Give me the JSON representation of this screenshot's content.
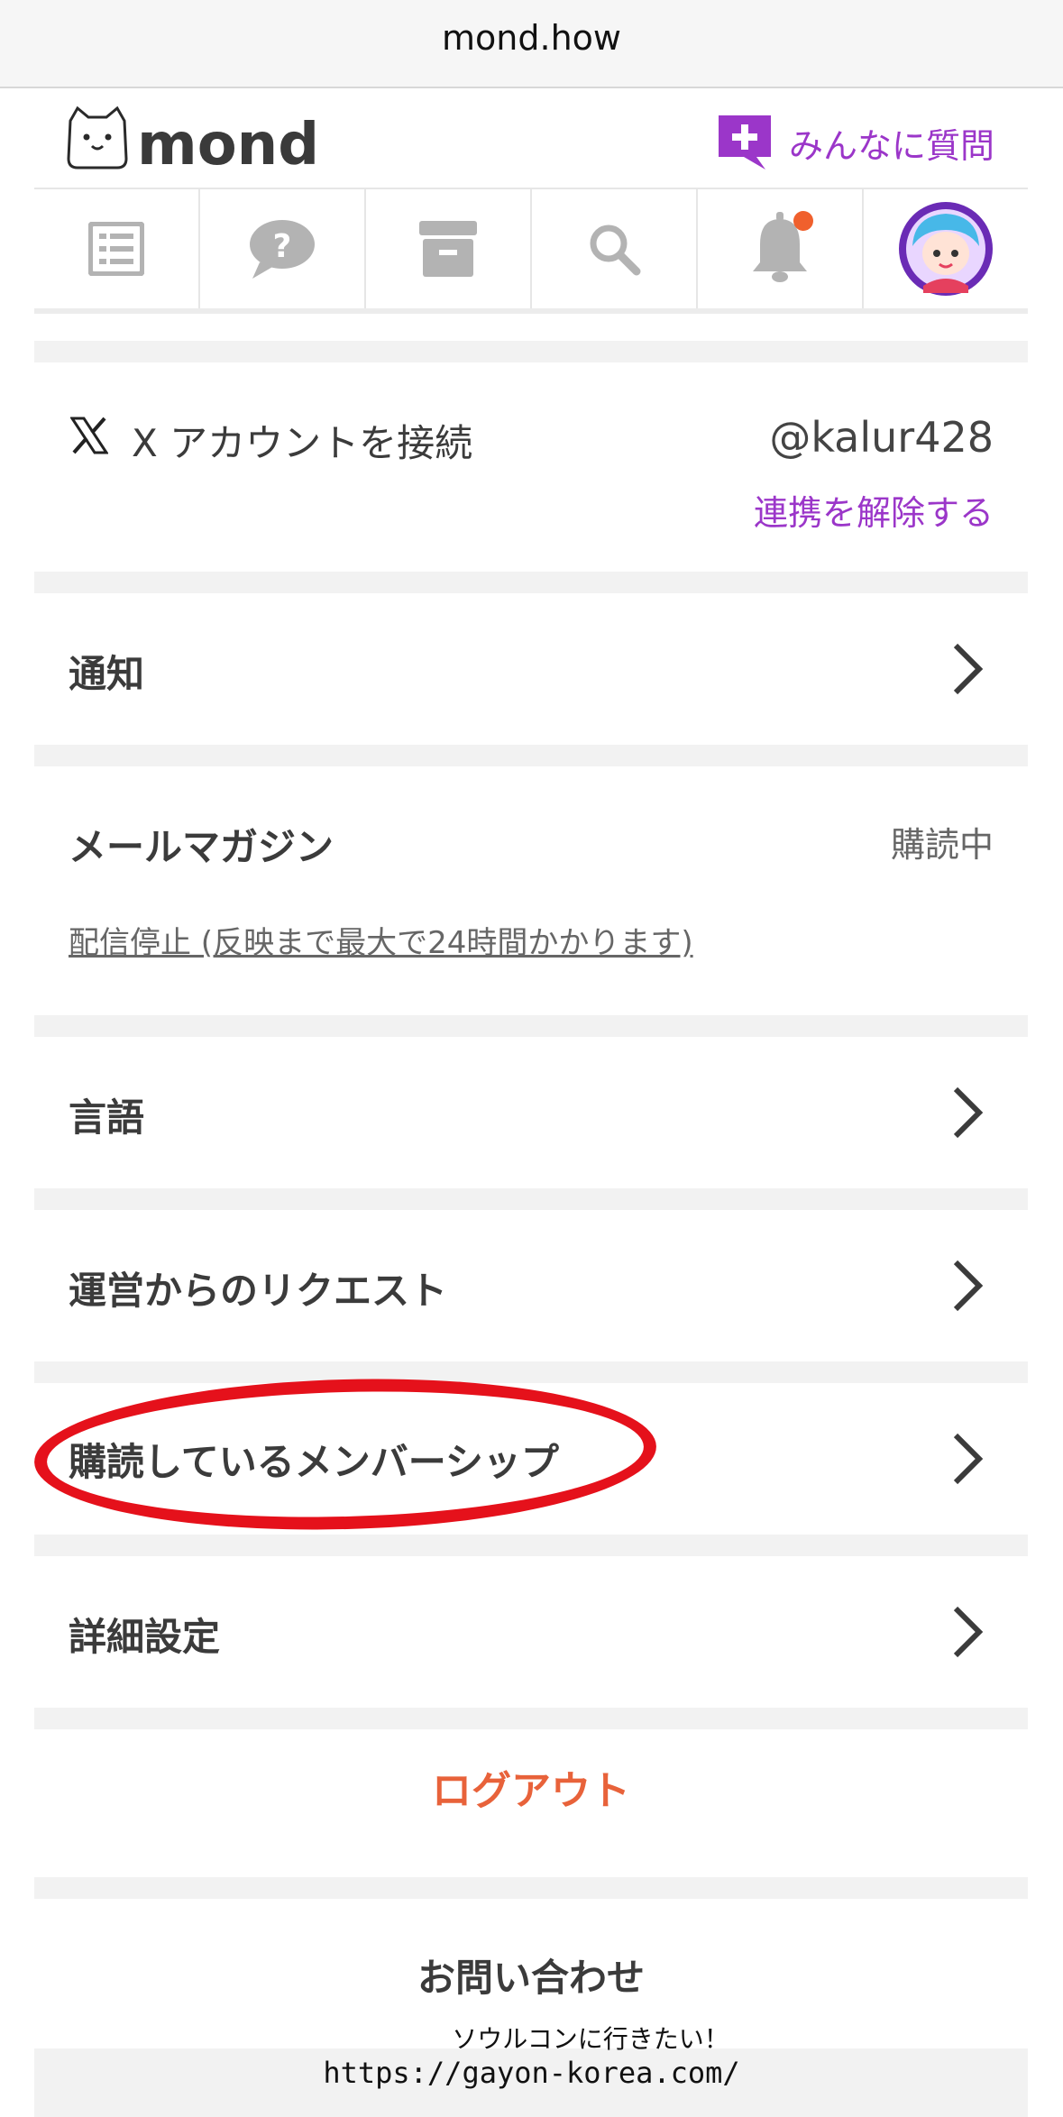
{
  "browser": {
    "url": "mond.how"
  },
  "header": {
    "logo_text": "mond",
    "ask_label": "みんなに質問"
  },
  "tabs": [
    {
      "icon": "list-icon"
    },
    {
      "icon": "question-bubble-icon"
    },
    {
      "icon": "archive-box-icon"
    },
    {
      "icon": "search-icon"
    },
    {
      "icon": "bell-icon",
      "badge": true
    },
    {
      "icon": "avatar"
    }
  ],
  "x_account": {
    "label": "X アカウントを接続",
    "handle": "@kalur428",
    "unlink": "連携を解除する"
  },
  "notifications": {
    "label": "通知"
  },
  "mail_magazine": {
    "label": "メールマガジン",
    "status": "購読中",
    "unsubscribe": "配信停止 (反映まで最大で24時間かかります)"
  },
  "language": {
    "label": "言語"
  },
  "request": {
    "label": "運営からのリクエスト"
  },
  "membership": {
    "label": "購読しているメンバーシップ"
  },
  "advanced": {
    "label": "詳細設定"
  },
  "logout": "ログアウト",
  "contact": "お問い合わせ",
  "watermark": {
    "line1": "ソウルコンに行きたい！",
    "line2": "https://gayon-korea.com/"
  },
  "colors": {
    "accent": "#9b36c9",
    "logout": "#e8623a",
    "badge": "#f0602d",
    "highlight": "#e5111b"
  }
}
